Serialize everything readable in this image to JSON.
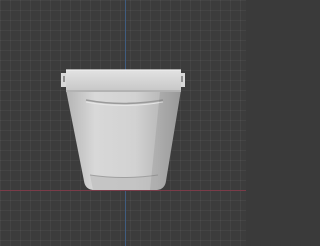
{
  "viewport": {
    "background_color": "#3c3c3c",
    "grid": true,
    "axes": {
      "y_axis_color": "#3f5f86",
      "x_axis_color": "#7a3b48"
    }
  },
  "object": {
    "name": "bucket",
    "color": "#cfcfcf"
  }
}
